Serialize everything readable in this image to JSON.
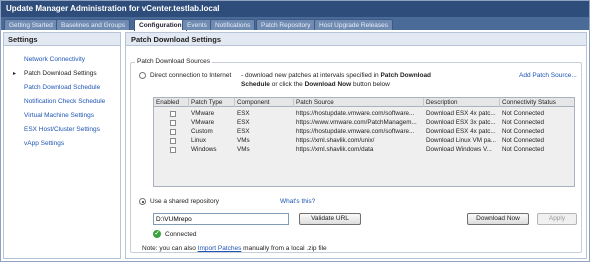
{
  "window": {
    "title": "Update Manager Administration for vCenter.testlab.local"
  },
  "tabs": [
    {
      "label": "Getting Started",
      "active": false
    },
    {
      "label": "Baselines and Groups",
      "active": false
    },
    {
      "label": "Configuration",
      "active": true
    },
    {
      "label": "Events",
      "active": false
    },
    {
      "label": "Notifications",
      "active": false
    },
    {
      "label": "Patch Repository",
      "active": false
    },
    {
      "label": "Host Upgrade Releases",
      "active": false
    }
  ],
  "sidebar": {
    "header": "Settings",
    "items": [
      {
        "label": "Network Connectivity",
        "active": false
      },
      {
        "label": "Patch Download Settings",
        "active": true
      },
      {
        "label": "Patch Download Schedule",
        "active": false
      },
      {
        "label": "Notification Check Schedule",
        "active": false
      },
      {
        "label": "Virtual Machine Settings",
        "active": false
      },
      {
        "label": "ESX Host/Cluster Settings",
        "active": false
      },
      {
        "label": "vApp Settings",
        "active": false
      }
    ]
  },
  "main": {
    "header": "Patch Download Settings",
    "group_legend": "Patch Download Sources",
    "direct": {
      "label": "Direct connection to Internet",
      "desc_line1_prefix": "-  download new patches at intervals specified in ",
      "desc_line1_bold": "Patch Download",
      "desc_line2_bold_a": "Schedule",
      "desc_line2_mid": " or click the ",
      "desc_line2_bold_b": "Download Now",
      "desc_line2_suffix": " button below",
      "add_patch_source": "Add Patch Source..."
    },
    "table": {
      "columns": [
        "Enabled",
        "Patch Type",
        "Component",
        "Patch Source",
        "Description",
        "Connectivity Status"
      ],
      "rows": [
        {
          "type": "VMware",
          "component": "ESX",
          "source": "https://hostupdate.vmware.com/software...",
          "description": "Download ESX 4x patc...",
          "status": "Not Connected"
        },
        {
          "type": "VMware",
          "component": "ESX",
          "source": "https://www.vmware.com/PatchManagem...",
          "description": "Download ESX 3x patc...",
          "status": "Not Connected"
        },
        {
          "type": "Custom",
          "component": "ESX",
          "source": "https://hostupdate.vmware.com/software...",
          "description": "Download ESX 4x patc...",
          "status": "Not Connected"
        },
        {
          "type": "Linux",
          "component": "VMs",
          "source": "https://xml.shavlik.com/unix/",
          "description": "Download Linux VM pa...",
          "status": "Not Connected"
        },
        {
          "type": "Windows",
          "component": "VMs",
          "source": "https://xml.shavlik.com/data",
          "description": "Download Windows V...",
          "status": "Not Connected"
        }
      ]
    },
    "shared": {
      "label": "Use a shared repository",
      "whats_this": "What's this?",
      "path_value": "D:\\VUMrepo",
      "validate_label": "Validate URL",
      "download_now_label": "Download Now",
      "apply_label": "Apply",
      "connected_label": "Connected"
    },
    "note": {
      "prefix": "Note: you can also ",
      "link": "Import Patches",
      "suffix": " manually from a local .zip file"
    }
  },
  "colors": {
    "title_bar": "#2e4d7b",
    "tab_strip": "#4a6a97",
    "link": "#1f55b5",
    "connected": "#3aa23a"
  }
}
